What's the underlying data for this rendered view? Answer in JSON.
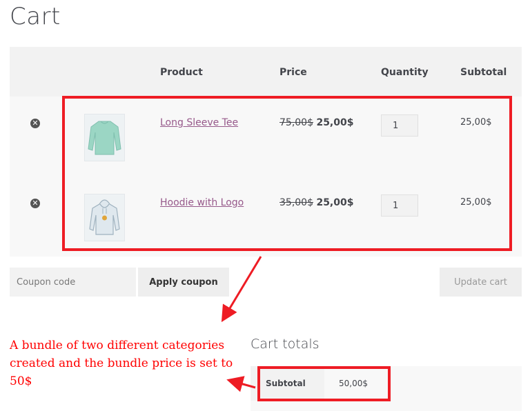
{
  "page": {
    "title": "Cart"
  },
  "table": {
    "headers": {
      "product": "Product",
      "price": "Price",
      "quantity": "Quantity",
      "subtotal": "Subtotal"
    },
    "rows": [
      {
        "name": "Long Sleeve Tee",
        "regular_price": "75,00$",
        "sale_price": "25,00$",
        "quantity": "1",
        "subtotal": "25,00$",
        "remove_icon": "remove-circle-icon",
        "thumbnail": "long-sleeve-tee"
      },
      {
        "name": "Hoodie with Logo",
        "regular_price": "35,00$",
        "sale_price": "25,00$",
        "quantity": "1",
        "subtotal": "25,00$",
        "remove_icon": "remove-circle-icon",
        "thumbnail": "hoodie-with-logo"
      }
    ]
  },
  "actions": {
    "coupon_placeholder": "Coupon code",
    "apply_label": "Apply coupon",
    "update_label": "Update cart"
  },
  "totals": {
    "title": "Cart totals",
    "subtotal_label": "Subtotal",
    "subtotal_value": "50,00$"
  },
  "annotation": {
    "text": "A bundle of two different categories created and the bundle price is set to 50$",
    "color": "#ff0000"
  },
  "colors": {
    "accent_link": "#96588a",
    "highlight": "#ee1c24"
  }
}
